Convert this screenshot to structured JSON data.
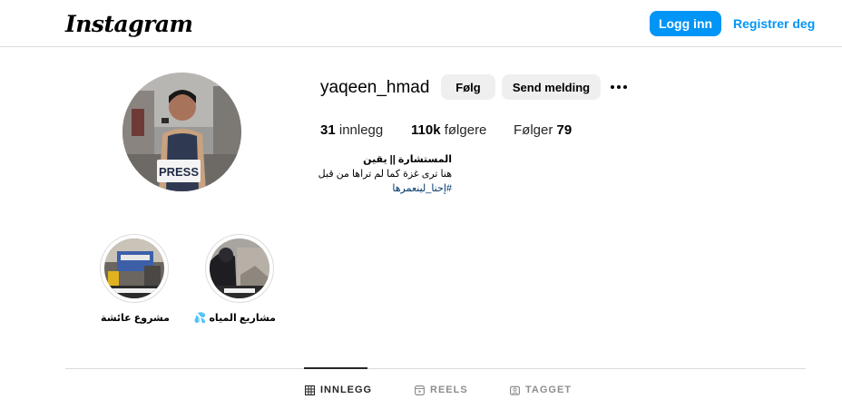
{
  "header": {
    "logo": "Instagram",
    "login_label": "Logg inn",
    "register_label": "Registrer deg"
  },
  "profile": {
    "username": "yaqeen_hmad",
    "follow_label": "Følg",
    "message_label": "Send melding",
    "more_icon": "more-horizontal-icon",
    "posts_count": "31",
    "posts_label": "innlegg",
    "followers_count": "110k",
    "followers_label": "følgere",
    "following_label": "Følger",
    "following_count": "79",
    "bio_name": "المستشارة || يقين",
    "bio_line": "هنا ترى غزة كما لم تراها من قبل",
    "bio_hashtag": "#إحنا_لينعمرها",
    "avatar_badge": "PRESS"
  },
  "highlights": [
    {
      "label": "مشروع عائشة",
      "caption": "..."
    },
    {
      "label": "مشاريع المياه 💦",
      "caption": "..."
    }
  ],
  "tabs": [
    {
      "label": "INNLEGG",
      "icon": "grid-icon",
      "active": true
    },
    {
      "label": "REELS",
      "icon": "reels-icon",
      "active": false
    },
    {
      "label": "TAGGET",
      "icon": "tagged-icon",
      "active": false
    }
  ],
  "colors": {
    "accent": "#0095f6",
    "secondary_button": "#efefef",
    "border": "#dbdbdb",
    "hashtag": "#00376b"
  }
}
